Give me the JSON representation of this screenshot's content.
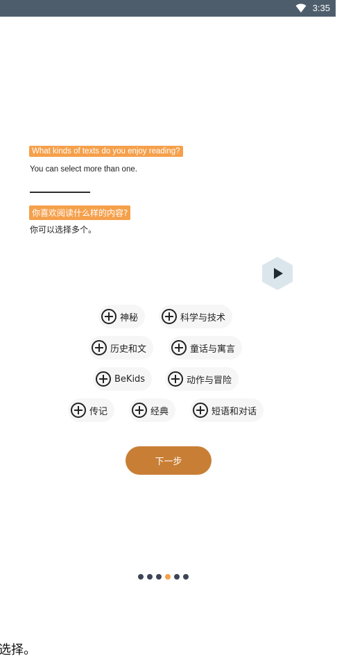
{
  "status_bar": {
    "time": "3:35",
    "wifi_icon": "wifi-icon"
  },
  "question": {
    "en_title": "What kinds of texts do you enjoy reading?",
    "en_subtitle": "You can select more than one.",
    "zh_title": "你喜欢阅读什么样的内容?",
    "zh_subtitle": "你可以选择多个。"
  },
  "play_icon": "play-icon",
  "categories": [
    {
      "label": "神秘"
    },
    {
      "label": "科学与技术"
    },
    {
      "label": "历史和文"
    },
    {
      "label": "童话与寓言"
    },
    {
      "label": "BeKids"
    },
    {
      "label": "动作与冒险"
    },
    {
      "label": "传记"
    },
    {
      "label": "经典"
    },
    {
      "label": "短语和对话"
    }
  ],
  "next_button": {
    "label": "下一步"
  },
  "pagination": {
    "total": 6,
    "current": 4
  },
  "bottom_text": "选择。",
  "colors": {
    "status_bar": "#4e5d6c",
    "highlight": "#f5a04b",
    "button": "#c87f35",
    "play_bg": "#dbe6ec",
    "dot": "#3d4556"
  }
}
